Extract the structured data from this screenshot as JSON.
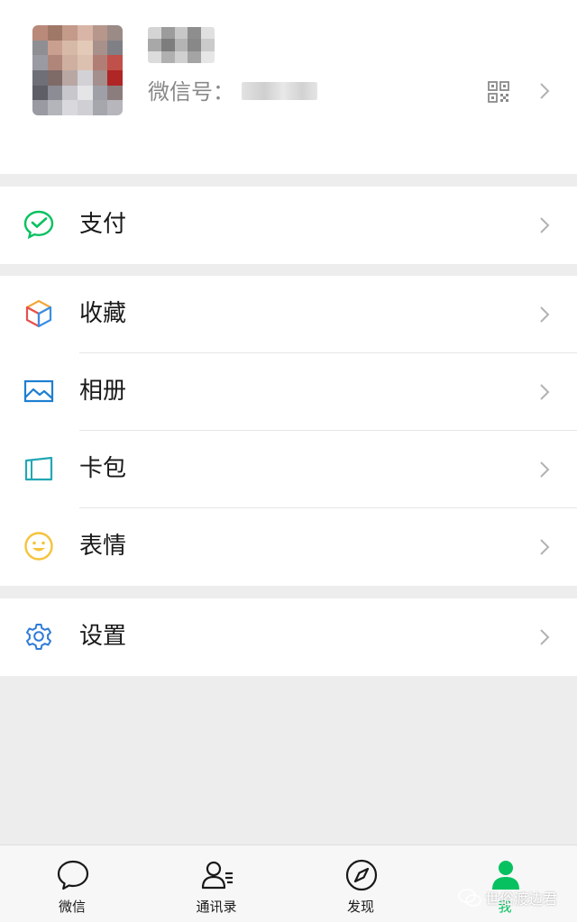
{
  "profile": {
    "wechat_id_label": "微信号：",
    "avatar_icon": "avatar-blurred",
    "qr_icon": "qr-code-icon"
  },
  "menu": {
    "pay": {
      "label": "支付",
      "icon": "wechat-pay-icon",
      "color": "#07c160"
    },
    "favorites": {
      "label": "收藏",
      "icon": "favorites-cube-icon"
    },
    "album": {
      "label": "相册",
      "icon": "album-icon",
      "color": "#1d7fd2"
    },
    "cards": {
      "label": "卡包",
      "icon": "card-wallet-icon",
      "color": "#22a7b4"
    },
    "stickers": {
      "label": "表情",
      "icon": "smile-icon",
      "color": "#f5c33b"
    },
    "settings": {
      "label": "设置",
      "icon": "gear-icon",
      "color": "#2f7bd7"
    }
  },
  "tabbar": {
    "chats": {
      "label": "微信",
      "icon": "chat-bubble-icon"
    },
    "contacts": {
      "label": "通讯录",
      "icon": "contacts-icon"
    },
    "discover": {
      "label": "发现",
      "icon": "compass-icon"
    },
    "me": {
      "label": "我",
      "icon": "person-icon",
      "active": true
    }
  },
  "watermark": {
    "text": "世俗渡边君"
  },
  "colors": {
    "accent": "#07c160",
    "background": "#ededed",
    "card": "#ffffff",
    "secondary_text": "#888888"
  }
}
